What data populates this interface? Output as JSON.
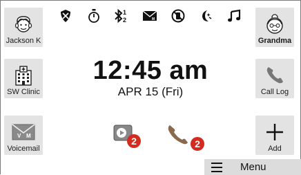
{
  "contacts_left": [
    {
      "label": "Jackson K",
      "icon": "boy-face-icon"
    },
    {
      "label": "SW Clinic",
      "icon": "hospital-building-icon"
    },
    {
      "label": "Voicemail",
      "icon": "voicemail-envelope-icon"
    }
  ],
  "contacts_right": [
    {
      "label": "Grandma",
      "icon": "grandma-face-icon"
    },
    {
      "label": "Call Log",
      "icon": "phone-handset-icon"
    },
    {
      "label": "Add",
      "icon": "plus-icon"
    }
  ],
  "status_icons": [
    "shield-icon",
    "stopwatch-icon",
    "bluetooth-icon",
    "mail-icon",
    "no-phone-icon",
    "night-mode-icon",
    "music-note-icon"
  ],
  "bluetooth_superscript": "1",
  "bluetooth_subscript": "2",
  "mail_letter": "M",
  "clock": {
    "time": "12:45 am",
    "date": "APR 15 (Fri)"
  },
  "notifications": {
    "voicemail_count": "2",
    "missed_calls_count": "2"
  },
  "voicemail_letters": {
    "v": "V",
    "m": "M"
  },
  "menu": {
    "label": "Menu",
    "icon": "hamburger-icon"
  },
  "colors": {
    "tile_bg": "#e3e3e3",
    "badge": "#d42b20",
    "phone_accent": "#8a6a4a",
    "menubar_bg": "#dcdcdc"
  }
}
